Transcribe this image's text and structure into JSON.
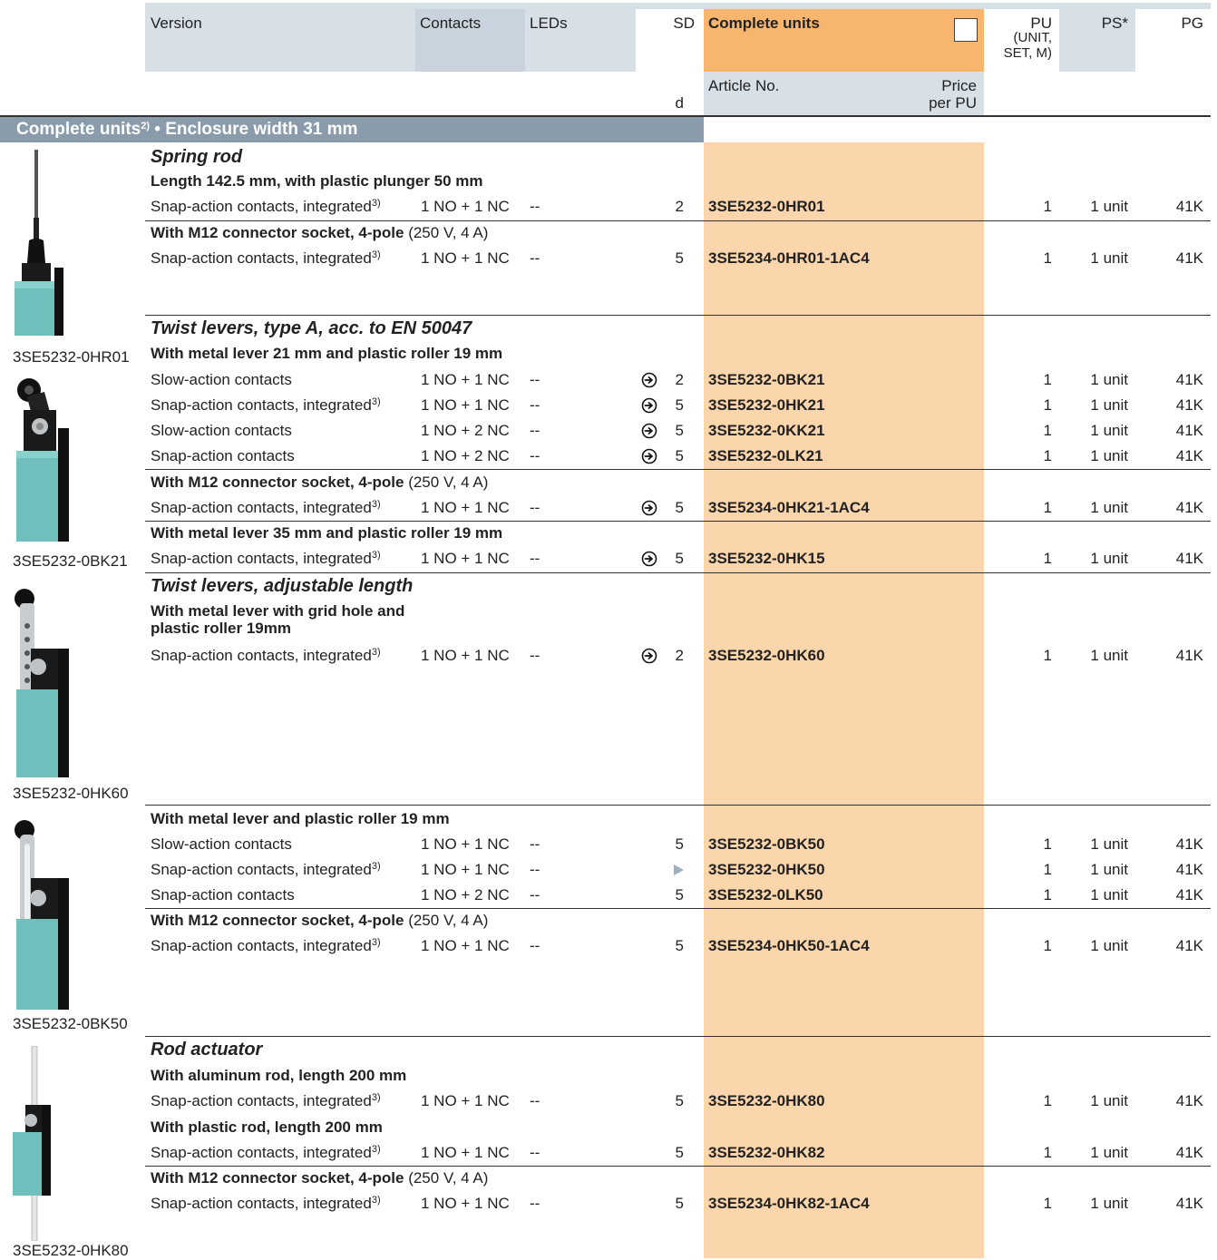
{
  "header": {
    "version": "Version",
    "contacts": "Contacts",
    "leds": "LEDs",
    "sd": "SD",
    "sd_unit": "d",
    "complete_units": "Complete units",
    "article_no": "Article No.",
    "price_line1": "Price",
    "price_line2": "per PU",
    "pu_line1": "PU",
    "pu_line2": "(UNIT,",
    "pu_line3": "SET, M)",
    "ps": "PS*",
    "pg": "PG"
  },
  "section_title": "Complete units",
  "section_title_sup": "2)",
  "section_title_rest": " • Enclosure width 31 mm",
  "colors": {
    "header_bar": "#d7dfe7",
    "section_bar": "#8a9bab",
    "complete_header": "#f7b56e",
    "complete_col": "#fbd5ac",
    "article_header": "#d7dfe7"
  },
  "captions": [
    "3SE5232-0HR01",
    "3SE5232-0BK21",
    "3SE5232-0HK60",
    "3SE5232-0BK50",
    "3SE5232-0HK80"
  ],
  "groups": {
    "spring_rod": "Spring rod",
    "length_plunger": "Length 142.5 mm, with plastic plunger 50 mm",
    "m12_prefix": "With M12 connector socket, 4-pole",
    "m12_suffix": " (250 V, 4 A)",
    "twist_a": "Twist levers, type A, acc. to EN 50047",
    "lever21": "With metal lever 21 mm and plastic roller 19 mm",
    "lever35": "With metal lever 35 mm and plastic roller 19 mm",
    "twist_adj": "Twist levers, adjustable length",
    "grid_line1": "With metal lever with grid hole and",
    "grid_line2": "plastic roller 19mm",
    "lever_roller": "With metal lever and plastic roller 19 mm",
    "rod_actuator": "Rod actuator",
    "alu_rod": "With aluminum rod, length 200 mm",
    "plastic_rod": "With plastic rod, length 200 mm"
  },
  "rows": [
    {
      "version": "Snap-action contacts, integrated",
      "sup": "3)",
      "contacts": "1 NO + 1 NC",
      "leds": "--",
      "arrow": false,
      "sd": "2",
      "article": "3SE5232-0HR01",
      "pu": "1",
      "ps": "1 unit",
      "pg": "41K"
    },
    {
      "version": "Snap-action contacts, integrated",
      "sup": "3)",
      "contacts": "1 NO + 1 NC",
      "leds": "--",
      "arrow": false,
      "sd": "5",
      "article": "3SE5234-0HR01-1AC4",
      "pu": "1",
      "ps": "1 unit",
      "pg": "41K"
    },
    {
      "version": "Slow-action contacts",
      "sup": "",
      "contacts": "1 NO + 1 NC",
      "leds": "--",
      "arrow": true,
      "sd": "2",
      "article": "3SE5232-0BK21",
      "pu": "1",
      "ps": "1 unit",
      "pg": "41K"
    },
    {
      "version": "Snap-action contacts, integrated",
      "sup": "3)",
      "contacts": "1 NO + 1 NC",
      "leds": "--",
      "arrow": true,
      "sd": "5",
      "article": "3SE5232-0HK21",
      "pu": "1",
      "ps": "1 unit",
      "pg": "41K"
    },
    {
      "version": "Slow-action contacts",
      "sup": "",
      "contacts": "1 NO + 2 NC",
      "leds": "--",
      "arrow": true,
      "sd": "5",
      "article": "3SE5232-0KK21",
      "pu": "1",
      "ps": "1 unit",
      "pg": "41K"
    },
    {
      "version": "Snap-action contacts",
      "sup": "",
      "contacts": "1 NO + 2 NC",
      "leds": "--",
      "arrow": true,
      "sd": "5",
      "article": "3SE5232-0LK21",
      "pu": "1",
      "ps": "1 unit",
      "pg": "41K"
    },
    {
      "version": "Snap-action contacts, integrated",
      "sup": "3)",
      "contacts": "1 NO + 1 NC",
      "leds": "--",
      "arrow": true,
      "sd": "5",
      "article": "3SE5234-0HK21-1AC4",
      "pu": "1",
      "ps": "1 unit",
      "pg": "41K"
    },
    {
      "version": "Snap-action contacts, integrated",
      "sup": "3)",
      "contacts": "1 NO + 1 NC",
      "leds": "--",
      "arrow": true,
      "sd": "5",
      "article": "3SE5232-0HK15",
      "pu": "1",
      "ps": "1 unit",
      "pg": "41K"
    },
    {
      "version": "Snap-action contacts, integrated",
      "sup": "3)",
      "contacts": "1 NO + 1 NC",
      "leds": "--",
      "arrow": true,
      "sd": "2",
      "article": "3SE5232-0HK60",
      "pu": "1",
      "ps": "1 unit",
      "pg": "41K"
    },
    {
      "version": "Slow-action contacts",
      "sup": "",
      "contacts": "1 NO + 1 NC",
      "leds": "--",
      "arrow": false,
      "sd": "5",
      "article": "3SE5232-0BK50",
      "pu": "1",
      "ps": "1 unit",
      "pg": "41K"
    },
    {
      "version": "Snap-action contacts, integrated",
      "sup": "3)",
      "contacts": "1 NO + 1 NC",
      "leds": "--",
      "arrow": false,
      "sd": "",
      "article": "3SE5232-0HK50",
      "pu": "1",
      "ps": "1 unit",
      "pg": "41K"
    },
    {
      "version": "Snap-action contacts",
      "sup": "",
      "contacts": "1 NO + 2 NC",
      "leds": "--",
      "arrow": false,
      "sd": "5",
      "article": "3SE5232-0LK50",
      "pu": "1",
      "ps": "1 unit",
      "pg": "41K"
    },
    {
      "version": "Snap-action contacts, integrated",
      "sup": "3)",
      "contacts": "1 NO + 1 NC",
      "leds": "--",
      "arrow": false,
      "sd": "5",
      "article": "3SE5234-0HK50-1AC4",
      "pu": "1",
      "ps": "1 unit",
      "pg": "41K"
    },
    {
      "version": "Snap-action contacts, integrated",
      "sup": "3)",
      "contacts": "1 NO + 1 NC",
      "leds": "--",
      "arrow": false,
      "sd": "5",
      "article": "3SE5232-0HK80",
      "pu": "1",
      "ps": "1 unit",
      "pg": "41K"
    },
    {
      "version": "Snap-action contacts, integrated",
      "sup": "3)",
      "contacts": "1 NO + 1 NC",
      "leds": "--",
      "arrow": false,
      "sd": "5",
      "article": "3SE5232-0HK82",
      "pu": "1",
      "ps": "1 unit",
      "pg": "41K"
    },
    {
      "version": "Snap-action contacts, integrated",
      "sup": "3)",
      "contacts": "1 NO + 1 NC",
      "leds": "--",
      "arrow": false,
      "sd": "5",
      "article": "3SE5234-0HK82-1AC4",
      "pu": "1",
      "ps": "1 unit",
      "pg": "41K"
    }
  ]
}
